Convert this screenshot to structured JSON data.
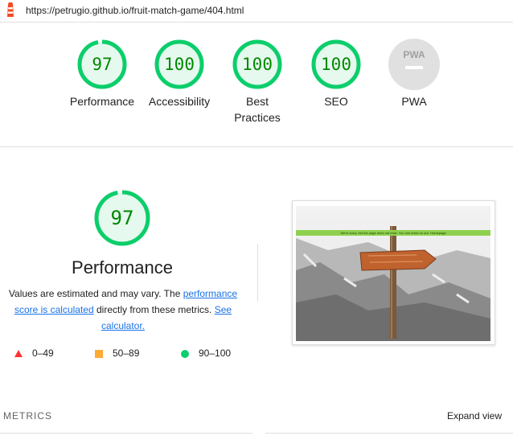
{
  "header": {
    "url": "https://petrugio.github.io/fruit-match-game/404.html"
  },
  "colors": {
    "pass": "#0cce6b",
    "pass_text": "#008800",
    "average": "#ffaa33",
    "fail": "#ff3333",
    "link": "#1a73e8"
  },
  "gauges": [
    {
      "score": "97",
      "label": "Performance",
      "fraction": 0.97
    },
    {
      "score": "100",
      "label": "Accessibility",
      "fraction": 1.0
    },
    {
      "score": "100",
      "label": "Best Practices",
      "fraction": 1.0
    },
    {
      "score": "100",
      "label": "SEO",
      "fraction": 1.0
    },
    {
      "score": "",
      "label": "PWA",
      "icon": "pwa-icon"
    }
  ],
  "performance": {
    "score": "97",
    "fraction": 0.97,
    "title": "Performance",
    "desc_1": "Values are estimated and may vary. The ",
    "link_1": "performance score is calculated",
    "desc_2": " directly from these metrics. ",
    "link_2": "See calculator."
  },
  "legend": {
    "fail": "0–49",
    "average": "50–89",
    "pass": "90–100"
  },
  "screenshot": {
    "banner_text": "We're sorry, but the page does not exist. You can return to our: Homepage"
  },
  "metrics": {
    "heading": "METRICS",
    "expand_label": "Expand view"
  }
}
